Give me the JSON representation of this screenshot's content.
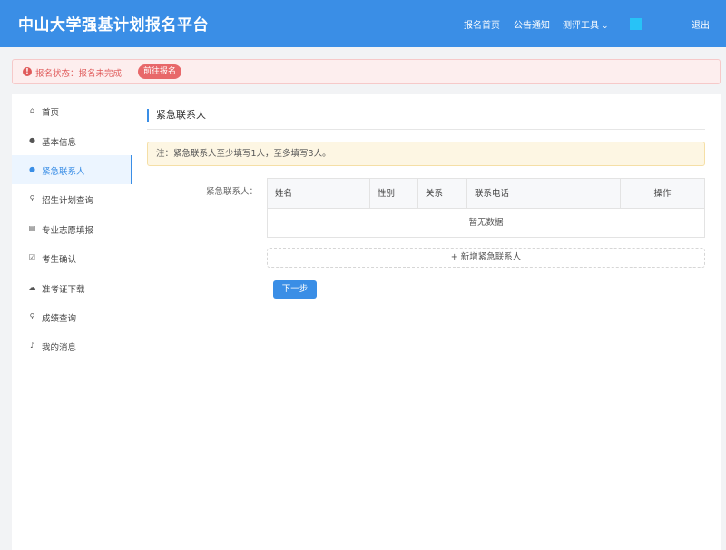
{
  "header": {
    "title": "中山大学强基计划报名平台",
    "nav": {
      "home": "报名首页",
      "notice": "公告通知",
      "tools": "测评工具",
      "logout": "退出"
    },
    "avatar_color": "#27c3f7"
  },
  "alert": {
    "status_text": "报名状态：报名未完成",
    "button": "前往报名"
  },
  "sidebar": {
    "items": [
      {
        "label": "首页",
        "icon": "home-icon"
      },
      {
        "label": "基本信息",
        "icon": "user-icon"
      },
      {
        "label": "紧急联系人",
        "icon": "user-icon",
        "active": true
      },
      {
        "label": "招生计划查询",
        "icon": "search-icon"
      },
      {
        "label": "专业志愿填报",
        "icon": "form-icon"
      },
      {
        "label": "考生确认",
        "icon": "check-square-icon"
      },
      {
        "label": "准考证下载",
        "icon": "cloud-download-icon"
      },
      {
        "label": "成绩查询",
        "icon": "search-icon"
      },
      {
        "label": "我的消息",
        "icon": "bell-icon"
      }
    ]
  },
  "main": {
    "section_title": "紧急联系人",
    "note": "注：紧急联系人至少填写1人，至多填写3人。",
    "field_label": "紧急联系人：",
    "table": {
      "columns": [
        "姓名",
        "性别",
        "关系",
        "联系电话",
        "操作"
      ],
      "empty_text": "暂无数据"
    },
    "add_button": "+ 新增紧急联系人",
    "next_button": "下一步"
  },
  "colors": {
    "primary": "#3a8ee6",
    "danger": "#e05a5a",
    "warning_bg": "#fdf6e3"
  }
}
